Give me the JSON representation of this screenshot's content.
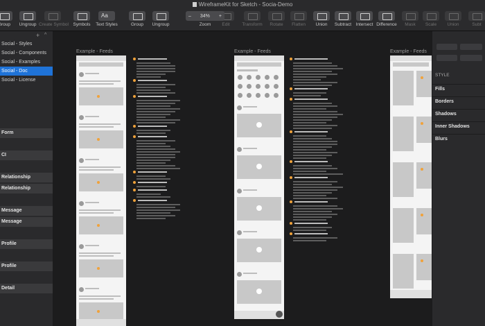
{
  "window": {
    "title": "WireframeKit for Sketch - Socia-Demo"
  },
  "toolbar": {
    "items": [
      {
        "label": "Group",
        "icon": "group-icon",
        "enabled": true
      },
      {
        "label": "Ungroup",
        "icon": "ungroup-icon",
        "enabled": true
      },
      {
        "label": "Create Symbol",
        "icon": "symbol-icon",
        "enabled": false
      },
      {
        "label": "Symbols",
        "icon": "symbols-icon",
        "enabled": true
      },
      {
        "label": "Text Styles",
        "icon": "text-styles-icon",
        "enabled": true
      },
      {
        "label": "Group",
        "icon": "group-icon",
        "enabled": true
      },
      {
        "label": "Ungroup",
        "icon": "ungroup-icon",
        "enabled": true
      },
      {
        "label": "Edit",
        "icon": "edit-icon",
        "enabled": false
      },
      {
        "label": "Transform",
        "icon": "transform-icon",
        "enabled": false
      },
      {
        "label": "Rotate",
        "icon": "rotate-icon",
        "enabled": false
      },
      {
        "label": "Flatten",
        "icon": "flatten-icon",
        "enabled": false
      },
      {
        "label": "Union",
        "icon": "union-icon",
        "enabled": true
      },
      {
        "label": "Subtract",
        "icon": "subtract-icon",
        "enabled": true
      },
      {
        "label": "Intersect",
        "icon": "intersect-icon",
        "enabled": true
      },
      {
        "label": "Difference",
        "icon": "difference-icon",
        "enabled": true
      },
      {
        "label": "Mask",
        "icon": "mask-icon",
        "enabled": false
      },
      {
        "label": "Scale",
        "icon": "scale-icon",
        "enabled": false
      },
      {
        "label": "Union",
        "icon": "union-icon",
        "enabled": false
      },
      {
        "label": "Subt",
        "icon": "subtract-icon",
        "enabled": false
      }
    ],
    "zoom": {
      "value": "34%",
      "minus": "–",
      "plus": "+",
      "label": "Zoom"
    },
    "aa_glyph": "Aa"
  },
  "sidebar": {
    "add_glyph": "+",
    "collapse_glyph": "^",
    "pages": [
      {
        "label": "Social - Styles",
        "selected": false
      },
      {
        "label": "Social - Components",
        "selected": false
      },
      {
        "label": "Social - Examples",
        "selected": false
      },
      {
        "label": "Social - Doc",
        "selected": true
      },
      {
        "label": "Social - License",
        "selected": false
      }
    ],
    "layers": [
      {
        "label": "Form",
        "kind": "group"
      },
      {
        "label": "",
        "kind": "sub"
      },
      {
        "label": "CI",
        "kind": "group"
      },
      {
        "label": "",
        "kind": "sub"
      },
      {
        "label": "Relationship",
        "kind": "group"
      },
      {
        "label": "Relationship",
        "kind": "group"
      },
      {
        "label": "",
        "kind": "sub"
      },
      {
        "label": "Message",
        "kind": "group"
      },
      {
        "label": "Message",
        "kind": "group"
      },
      {
        "label": "",
        "kind": "sub"
      },
      {
        "label": "Profile",
        "kind": "group"
      },
      {
        "label": "",
        "kind": "sub"
      },
      {
        "label": "Profile",
        "kind": "group"
      },
      {
        "label": "",
        "kind": "sub"
      },
      {
        "label": "Detail",
        "kind": "group"
      }
    ]
  },
  "canvas": {
    "artboards": [
      {
        "label": "Example - Feeds"
      },
      {
        "label": "Example - Feeds"
      },
      {
        "label": "Example - Feeds"
      }
    ]
  },
  "inspector": {
    "style_header": "STYLE",
    "sections": [
      "Fills",
      "Borders",
      "Shadows",
      "Inner Shadows",
      "Blurs"
    ]
  },
  "colors": {
    "accent": "#1f73d8",
    "annotation_dot": "#f0a23a",
    "toolbar_bg": "#2b2b2d",
    "canvas_bg": "#1c1c1d"
  }
}
